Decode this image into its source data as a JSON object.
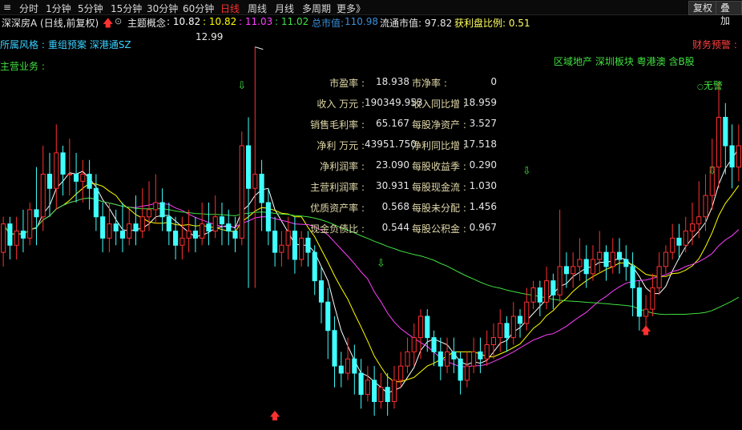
{
  "toolbar": {
    "periods": [
      "分时",
      "1分钟",
      "5分钟",
      "15分钟",
      "30分钟",
      "60分钟",
      "日线",
      "周线",
      "月线",
      "多周期",
      "更多》"
    ],
    "active": "日线",
    "buttons": [
      "复权",
      "叠加"
    ]
  },
  "info": {
    "title": "深深房A (日线,前复权)",
    "theme_label": "主题概念",
    "ma_values": [
      {
        "text": ": 10.82",
        "color": "#ffffff"
      },
      {
        "text": ": 10.82",
        "color": "#ffff00"
      },
      {
        "text": ": 11.03",
        "color": "#ff40ff"
      },
      {
        "text": ": 11.02",
        "color": "#40e040"
      }
    ],
    "total_mv_label": "总市值:",
    "total_mv_value": "110.98",
    "float_mv": "流通市值: 97.82",
    "profit_ratio": "获利盘比例: 0.51"
  },
  "style_label": "所属风格 :",
  "style_items": "重组预案 深港通SZ",
  "business_label": "主营业务 :",
  "finance_warning": "财务预警 :",
  "concepts": "区域地产  深圳板块  粤港澳  含B股",
  "no_warning": "无警",
  "high_label": "12.99",
  "fundamentals": [
    {
      "l1": "市盈率 :",
      "v1": "18.938",
      "l2": "市净率 :",
      "v2": "0"
    },
    {
      "l1": "收入 万元 :",
      "v1": "190349.953",
      "l2": "收入同比增 :",
      "v2": "18.959"
    },
    {
      "l1": "销售毛利率 :",
      "v1": "65.167",
      "l2": "每股净资产 :",
      "v2": "3.527"
    },
    {
      "l1": "净利 万元 :",
      "v1": "43951.750",
      "l2": "净利同比增 :",
      "v2": "17.518"
    },
    {
      "l1": "净利润率 :",
      "v1": "23.090",
      "l2": "每股收益季 :",
      "v2": "0.290"
    },
    {
      "l1": "主营利润率 :",
      "v1": "30.931",
      "l2": "每股现金流 :",
      "v2": "1.030"
    },
    {
      "l1": "优质资产率 :",
      "v1": "0.568",
      "l2": "每股未分配 :",
      "v2": "1.456"
    },
    {
      "l1": "现金负债比 :",
      "v1": "0.544",
      "l2": "每股公积金 :",
      "v2": "0.967"
    }
  ],
  "chart_data": {
    "type": "candlestick",
    "up_color": "#ff3030",
    "down_color": "#40ffff",
    "ma_colors": [
      "#ffffff",
      "#ffff00",
      "#ff40ff",
      "#40e040"
    ],
    "ylim": [
      7.6,
      13.2
    ],
    "candles": [
      [
        10.1,
        10.5,
        9.9,
        10.6
      ],
      [
        10.5,
        10.2,
        10.0,
        10.6
      ],
      [
        10.2,
        10.4,
        10.0,
        10.6
      ],
      [
        10.4,
        10.3,
        10.1,
        10.7
      ],
      [
        10.3,
        10.7,
        10.2,
        10.8
      ],
      [
        10.7,
        10.6,
        10.2,
        11.3
      ],
      [
        10.6,
        11.2,
        10.4,
        11.6
      ],
      [
        11.2,
        11.0,
        10.6,
        11.5
      ],
      [
        11.0,
        11.5,
        10.7,
        11.9
      ],
      [
        11.5,
        11.2,
        10.9,
        11.6
      ],
      [
        11.2,
        11.2,
        10.9,
        11.7
      ],
      [
        11.2,
        11.1,
        10.8,
        11.5
      ],
      [
        11.1,
        11.2,
        10.8,
        11.4
      ],
      [
        11.2,
        11.0,
        10.7,
        11.4
      ],
      [
        11.0,
        10.6,
        10.4,
        11.2
      ],
      [
        10.6,
        10.3,
        10.1,
        10.8
      ],
      [
        10.3,
        10.5,
        10.1,
        10.8
      ],
      [
        10.5,
        10.4,
        10.2,
        10.7
      ],
      [
        10.4,
        10.3,
        10.1,
        10.8
      ],
      [
        10.3,
        10.5,
        10.2,
        10.7
      ],
      [
        10.5,
        10.4,
        10.2,
        10.9
      ],
      [
        10.4,
        10.6,
        10.3,
        11.0
      ],
      [
        10.6,
        10.7,
        10.4,
        11.1
      ],
      [
        10.7,
        10.8,
        10.5,
        11.2
      ],
      [
        10.8,
        10.6,
        10.4,
        11.0
      ],
      [
        10.6,
        10.4,
        10.2,
        10.8
      ],
      [
        10.4,
        10.2,
        10.0,
        10.6
      ],
      [
        10.2,
        10.3,
        10.0,
        10.6
      ],
      [
        10.3,
        10.4,
        10.1,
        10.7
      ],
      [
        10.4,
        10.3,
        10.1,
        10.6
      ],
      [
        10.3,
        10.5,
        10.2,
        10.8
      ],
      [
        10.5,
        10.4,
        10.2,
        10.8
      ],
      [
        10.4,
        10.6,
        10.3,
        10.9
      ],
      [
        10.6,
        10.5,
        10.2,
        10.8
      ],
      [
        10.5,
        10.4,
        10.2,
        10.7
      ],
      [
        10.4,
        10.3,
        10.1,
        10.6
      ],
      [
        10.3,
        11.6,
        10.2,
        11.8
      ],
      [
        11.6,
        11.0,
        9.6,
        12.0
      ],
      [
        11.0,
        11.2,
        9.6,
        12.99
      ],
      [
        11.2,
        10.8,
        10.4,
        11.4
      ],
      [
        10.8,
        10.4,
        10.2,
        11.0
      ],
      [
        10.4,
        10.1,
        9.9,
        10.6
      ],
      [
        10.1,
        10.2,
        9.9,
        10.4
      ],
      [
        10.2,
        10.4,
        10.0,
        10.6
      ],
      [
        10.4,
        10.0,
        9.8,
        10.6
      ],
      [
        10.0,
        10.3,
        9.9,
        10.4
      ],
      [
        10.3,
        10.1,
        9.9,
        10.4
      ],
      [
        10.1,
        9.7,
        9.5,
        10.2
      ],
      [
        9.7,
        9.4,
        9.1,
        9.9
      ],
      [
        9.4,
        9.0,
        8.6,
        9.6
      ],
      [
        9.0,
        8.5,
        8.2,
        9.2
      ],
      [
        8.5,
        8.4,
        8.2,
        8.7
      ],
      [
        8.4,
        8.6,
        8.3,
        8.9
      ],
      [
        8.6,
        8.4,
        8.1,
        8.8
      ],
      [
        8.4,
        8.1,
        7.9,
        8.6
      ],
      [
        8.1,
        8.3,
        8.0,
        8.5
      ],
      [
        8.3,
        8.0,
        7.8,
        8.5
      ],
      [
        8.0,
        8.2,
        7.9,
        8.4
      ],
      [
        8.2,
        8.0,
        7.8,
        8.4
      ],
      [
        8.0,
        8.3,
        7.9,
        8.5
      ],
      [
        8.3,
        8.5,
        8.2,
        8.7
      ],
      [
        8.5,
        8.7,
        8.4,
        8.9
      ],
      [
        8.7,
        8.9,
        8.5,
        9.1
      ],
      [
        8.9,
        9.2,
        8.6,
        9.3
      ],
      [
        9.2,
        8.9,
        8.7,
        9.3
      ],
      [
        8.9,
        8.7,
        8.5,
        9.0
      ],
      [
        8.7,
        8.5,
        8.3,
        8.9
      ],
      [
        8.5,
        8.7,
        8.4,
        8.9
      ],
      [
        8.7,
        8.6,
        8.4,
        8.9
      ],
      [
        8.6,
        8.3,
        8.1,
        8.7
      ],
      [
        8.3,
        8.5,
        8.2,
        8.7
      ],
      [
        8.5,
        8.7,
        8.4,
        8.9
      ],
      [
        8.7,
        8.6,
        8.4,
        8.9
      ],
      [
        8.6,
        8.8,
        8.5,
        9.0
      ],
      [
        8.8,
        8.9,
        8.6,
        9.1
      ],
      [
        8.9,
        9.1,
        8.7,
        9.3
      ],
      [
        9.1,
        8.9,
        8.7,
        9.2
      ],
      [
        8.9,
        9.2,
        8.8,
        9.4
      ],
      [
        9.2,
        9.1,
        8.9,
        9.3
      ],
      [
        9.1,
        9.4,
        9.0,
        9.6
      ],
      [
        9.4,
        9.6,
        9.3,
        9.7
      ],
      [
        9.6,
        9.4,
        9.2,
        9.7
      ],
      [
        9.4,
        9.7,
        9.3,
        9.9
      ],
      [
        9.7,
        9.5,
        9.3,
        9.8
      ],
      [
        9.5,
        9.9,
        9.4,
        10.7
      ],
      [
        9.9,
        9.8,
        9.6,
        10.1
      ],
      [
        9.8,
        9.9,
        9.6,
        10.1
      ],
      [
        9.9,
        10.0,
        9.7,
        10.3
      ],
      [
        10.0,
        9.8,
        9.6,
        10.2
      ],
      [
        9.8,
        10.0,
        9.7,
        10.2
      ],
      [
        10.0,
        10.1,
        9.8,
        10.4
      ],
      [
        10.1,
        9.9,
        9.7,
        10.2
      ],
      [
        9.9,
        10.1,
        9.8,
        10.3
      ],
      [
        10.1,
        10.0,
        9.8,
        10.3
      ],
      [
        10.0,
        9.9,
        9.7,
        10.2
      ],
      [
        9.9,
        9.6,
        9.2,
        10.1
      ],
      [
        9.6,
        9.2,
        9.0,
        9.7
      ],
      [
        9.2,
        9.3,
        9.0,
        9.5
      ],
      [
        9.3,
        9.6,
        9.2,
        9.8
      ],
      [
        9.6,
        9.9,
        9.5,
        10.1
      ],
      [
        9.9,
        10.1,
        9.8,
        10.2
      ],
      [
        10.1,
        10.3,
        10.0,
        10.5
      ],
      [
        10.3,
        10.2,
        10.0,
        10.5
      ],
      [
        10.2,
        10.4,
        10.1,
        10.6
      ],
      [
        10.4,
        10.5,
        10.2,
        10.8
      ],
      [
        10.5,
        10.6,
        10.3,
        11.1
      ],
      [
        10.6,
        10.9,
        10.4,
        11.2
      ],
      [
        10.9,
        11.3,
        10.7,
        11.7
      ],
      [
        11.3,
        12.0,
        11.0,
        12.5
      ],
      [
        12.0,
        11.6,
        11.2,
        12.2
      ],
      [
        11.6,
        11.3,
        11.0,
        11.9
      ],
      [
        11.3,
        11.6,
        11.1,
        11.9
      ]
    ]
  }
}
